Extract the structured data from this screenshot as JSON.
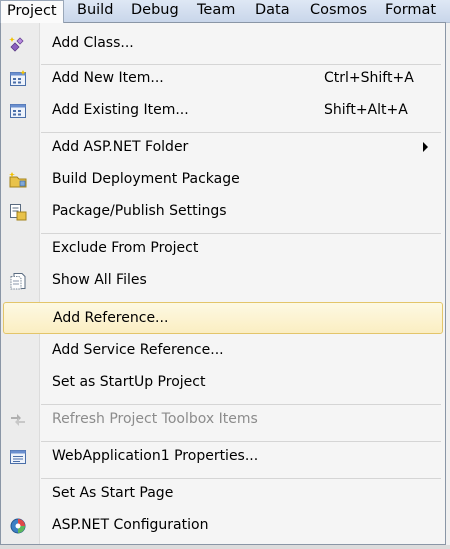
{
  "menubar": {
    "items": [
      "Project",
      "Build",
      "Debug",
      "Team",
      "Data",
      "Cosmos",
      "Format"
    ]
  },
  "menu": {
    "add_class": "Add Class...",
    "add_new_item": "Add New Item...",
    "add_new_item_shortcut": "Ctrl+Shift+A",
    "add_existing_item": "Add Existing Item...",
    "add_existing_item_shortcut": "Shift+Alt+A",
    "add_aspnet_folder": "Add ASP.NET Folder",
    "build_deployment_package": "Build Deployment Package",
    "package_publish_settings": "Package/Publish Settings",
    "exclude_from_project": "Exclude From Project",
    "show_all_files": "Show All Files",
    "add_reference": "Add Reference...",
    "add_service_reference": "Add Service Reference...",
    "set_as_startup": "Set as StartUp Project",
    "refresh_toolbox": "Refresh Project Toolbox Items",
    "properties": "WebApplication1 Properties...",
    "set_as_start_page": "Set As Start Page",
    "aspnet_configuration": "ASP.NET Configuration"
  },
  "state": {
    "active_menu": "Project",
    "highlighted_item": "Add Reference...",
    "disabled_items": [
      "Refresh Project Toolbox Items"
    ]
  },
  "colors": {
    "highlight_fill": "#fbeec2",
    "highlight_border": "#e3c56a",
    "disabled_text": "#8c8c8c",
    "menu_bar": "#c9d6ea"
  }
}
